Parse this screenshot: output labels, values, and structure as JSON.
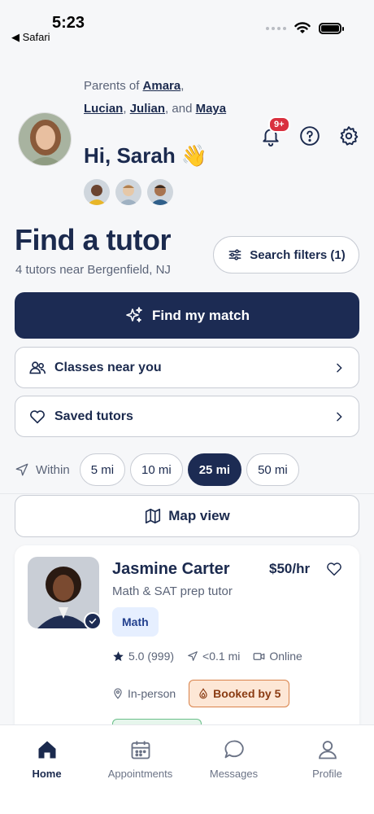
{
  "status_bar": {
    "time": "5:23",
    "back_label": "◀ Safari"
  },
  "header": {
    "parents_prefix": "Parents of",
    "kids": [
      "Amara",
      "Lucian",
      "Julian",
      "Maya"
    ],
    "and_word": "and",
    "greeting": "Hi, Sarah 👋",
    "notifications_badge": "9+"
  },
  "find": {
    "title": "Find a tutor",
    "subtitle": "4 tutors near Bergenfield, NJ",
    "filters_label": "Search filters (1)",
    "match_label": "Find my match",
    "classes_label": "Classes near you",
    "saved_label": "Saved tutors"
  },
  "distance": {
    "label": "Within",
    "options": [
      "5 mi",
      "10 mi",
      "25 mi",
      "50 mi"
    ],
    "selected": "25 mi"
  },
  "map_view_label": "Map view",
  "tutor_card": {
    "name": "Jasmine Carter",
    "rate": "$50/hr",
    "description": "Math & SAT prep tutor",
    "subject": "Math",
    "rating": "5.0 (999)",
    "distance": "<0.1 mi",
    "online": "Online",
    "in_person": "In-person",
    "booked": "Booked by 5"
  },
  "tabs": [
    {
      "label": "Home",
      "icon": "home-icon"
    },
    {
      "label": "Appointments",
      "icon": "calendar-icon"
    },
    {
      "label": "Messages",
      "icon": "chat-icon"
    },
    {
      "label": "Profile",
      "icon": "person-icon"
    }
  ],
  "colors": {
    "navy": "#1c2b53",
    "badge_red": "#d9303f",
    "booked_orange": "#d9824a"
  }
}
